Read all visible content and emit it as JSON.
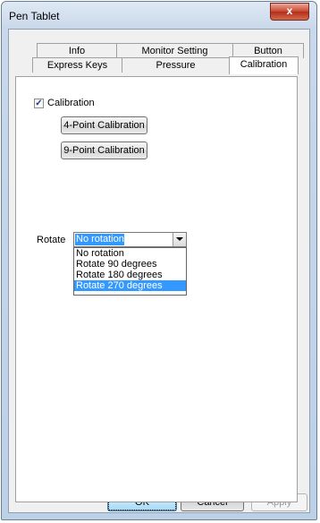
{
  "window": {
    "title": "Pen Tablet",
    "close_glyph": "x"
  },
  "tabs": {
    "row1": [
      "Info",
      "Monitor Setting",
      "Button"
    ],
    "row2": [
      "Express Keys",
      "Pressure",
      "Calibration"
    ]
  },
  "calibration": {
    "checkbox_label": "Calibration",
    "checked": true,
    "check_glyph": "✓",
    "button_4pt": "4-Point Calibration",
    "button_9pt": "9-Point Calibration"
  },
  "rotate": {
    "label": "Rotate",
    "selected": "No rotation",
    "options": [
      "No rotation",
      "Rotate 90 degrees",
      "Rotate 180 degrees",
      "Rotate 270 degrees"
    ],
    "highlighted_option": "Rotate 270 degrees"
  },
  "footer": {
    "ok": "OK",
    "cancel": "Cancel",
    "apply": "Apply"
  }
}
